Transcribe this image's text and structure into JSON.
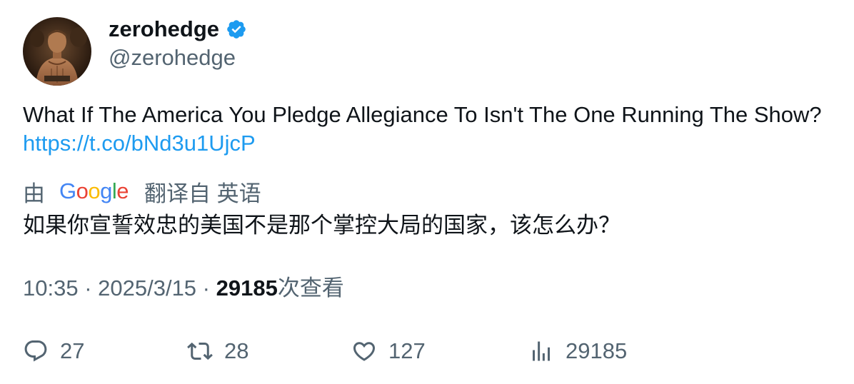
{
  "author": {
    "display_name": "zerohedge",
    "handle": "@zerohedge",
    "verified_icon": "verified-badge-icon",
    "avatar_icon": "avatar"
  },
  "tweet": {
    "text": "What If The America You Pledge Allegiance To Isn't The One Running The Show? ",
    "link": "https://t.co/bNd3u1UjcP"
  },
  "translation": {
    "prefix": "由",
    "provider": "Google",
    "suffix": "翻译自 英语",
    "text": "如果你宣誓效忠的美国不是那个掌控大局的国家，该怎么办？"
  },
  "meta": {
    "time": "10:35",
    "separator": " · ",
    "date": "2025/3/15",
    "views_count": "29185",
    "views_label": "次查看"
  },
  "actions": {
    "replies": "27",
    "retweets": "28",
    "likes": "127",
    "views": "29185"
  },
  "colors": {
    "text": "#0f1419",
    "secondary": "#536471",
    "link": "#1d9bf0",
    "verified": "#1d9bf0"
  }
}
